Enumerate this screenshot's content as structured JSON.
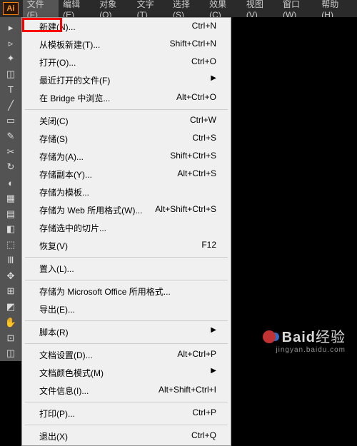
{
  "app": {
    "logo": "Ai"
  },
  "menubar": [
    {
      "label": "文件(F)",
      "active": true
    },
    {
      "label": "编辑(E)"
    },
    {
      "label": "对象(O)"
    },
    {
      "label": "文字(T)"
    },
    {
      "label": "选择(S)"
    },
    {
      "label": "效果(C)"
    },
    {
      "label": "视图(V)"
    },
    {
      "label": "窗口(W)"
    },
    {
      "label": "帮助(H)"
    }
  ],
  "dropdown": [
    {
      "label": "新建(N)...",
      "shortcut": "Ctrl+N",
      "highlighted": true
    },
    {
      "label": "从模板新建(T)...",
      "shortcut": "Shift+Ctrl+N"
    },
    {
      "label": "打开(O)...",
      "shortcut": "Ctrl+O"
    },
    {
      "label": "最近打开的文件(F)",
      "submenu": true
    },
    {
      "label": "在 Bridge 中浏览...",
      "shortcut": "Alt+Ctrl+O"
    },
    {
      "sep": true
    },
    {
      "label": "关闭(C)",
      "shortcut": "Ctrl+W"
    },
    {
      "label": "存储(S)",
      "shortcut": "Ctrl+S"
    },
    {
      "label": "存储为(A)...",
      "shortcut": "Shift+Ctrl+S"
    },
    {
      "label": "存储副本(Y)...",
      "shortcut": "Alt+Ctrl+S"
    },
    {
      "label": "存储为模板..."
    },
    {
      "label": "存储为 Web 所用格式(W)...",
      "shortcut": "Alt+Shift+Ctrl+S"
    },
    {
      "label": "存储选中的切片..."
    },
    {
      "label": "恢复(V)",
      "shortcut": "F12"
    },
    {
      "sep": true
    },
    {
      "label": "置入(L)..."
    },
    {
      "sep": true
    },
    {
      "label": "存储为 Microsoft Office 所用格式..."
    },
    {
      "label": "导出(E)..."
    },
    {
      "sep": true
    },
    {
      "label": "脚本(R)",
      "submenu": true
    },
    {
      "sep": true
    },
    {
      "label": "文档设置(D)...",
      "shortcut": "Alt+Ctrl+P"
    },
    {
      "label": "文档颜色模式(M)",
      "submenu": true
    },
    {
      "label": "文件信息(I)...",
      "shortcut": "Alt+Shift+Ctrl+I"
    },
    {
      "sep": true
    },
    {
      "label": "打印(P)...",
      "shortcut": "Ctrl+P"
    },
    {
      "sep": true
    },
    {
      "label": "退出(X)",
      "shortcut": "Ctrl+Q"
    }
  ],
  "tools": [
    "▸",
    "▹",
    "✦",
    "◫",
    "T",
    "╱",
    "▭",
    "✎",
    "✂",
    "↻",
    "◐",
    "▦",
    "▤",
    "◧",
    "⬚",
    "Ⅲ",
    "✥",
    "⊞",
    "◩",
    "✋",
    "⊡",
    "◫"
  ],
  "watermark": {
    "main": "Baid",
    "sub": "经验",
    "url": "jingyan.baidu.com"
  }
}
